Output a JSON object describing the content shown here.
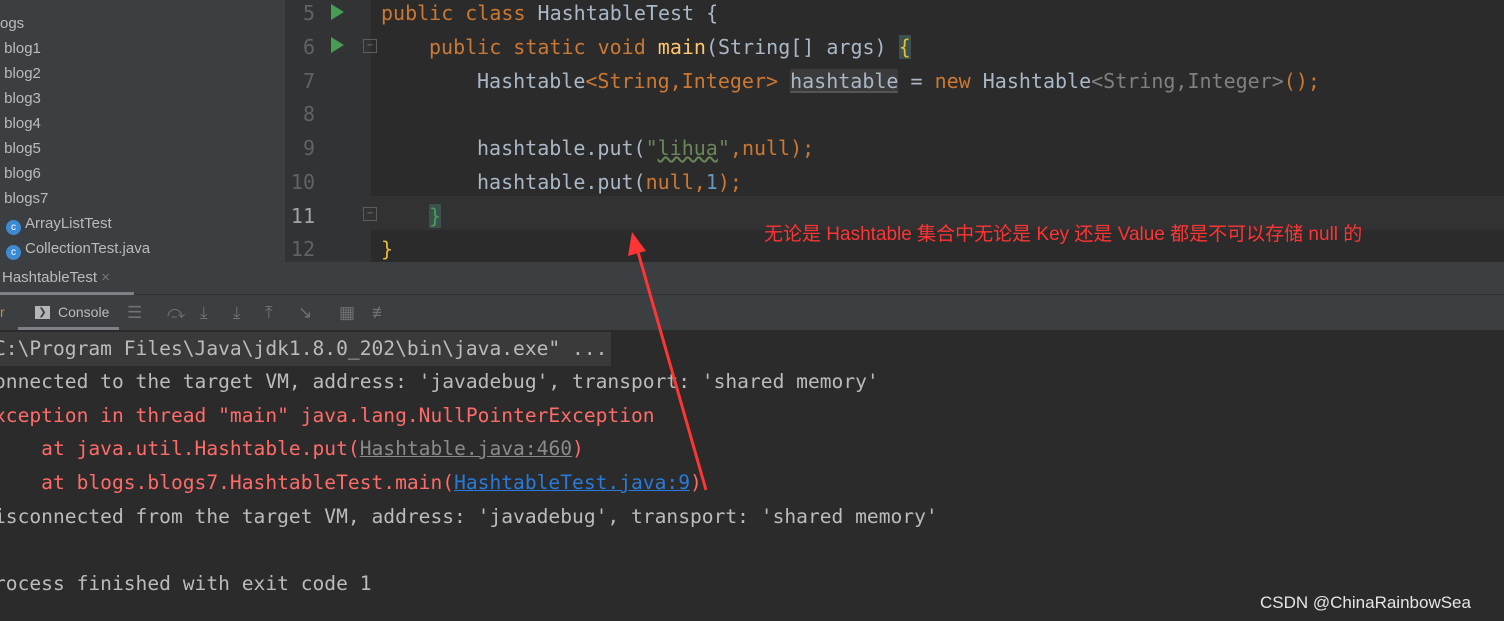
{
  "sidebar": {
    "items": [
      {
        "label": "ogs",
        "type": "folder"
      },
      {
        "label": "blog1",
        "type": "folder"
      },
      {
        "label": "blog2",
        "type": "folder"
      },
      {
        "label": "blog3",
        "type": "folder"
      },
      {
        "label": "blog4",
        "type": "folder"
      },
      {
        "label": "blog5",
        "type": "folder"
      },
      {
        "label": "blog6",
        "type": "folder"
      },
      {
        "label": "blogs7",
        "type": "folder"
      },
      {
        "label": "ArrayListTest",
        "type": "class"
      },
      {
        "label": "CollectionTest.java",
        "type": "class"
      }
    ]
  },
  "editor": {
    "line_numbers": [
      "5",
      "6",
      "7",
      "8",
      "9",
      "10",
      "11",
      "12"
    ],
    "lines": {
      "l5": {
        "kw": "public class ",
        "name": "HashtableTest {"
      },
      "l6": {
        "kw": "public static void ",
        "fn": "main",
        "rest": "(String[] args) ",
        "brace": "{"
      },
      "l7": {
        "a": "Hashtable",
        "b": "<String,Integer> ",
        "var": "hashtable",
        "c": " = ",
        "kw": "new ",
        "d": "Hashtable",
        "e": "<String,Integer>",
        "f": "();"
      },
      "l9": {
        "a": "hashtable.put(",
        "q1": "\"",
        "s": "lihua",
        "q2": "\"",
        "c": ",",
        "kw": "null",
        "d": ");"
      },
      "l10": {
        "a": "hashtable.put(",
        "kw": "null",
        "c": ",",
        "n": "1",
        "d": ");"
      },
      "l11": {
        "brace": "}"
      },
      "l12": {
        "brace": "}"
      }
    }
  },
  "run_tab": {
    "label": "HashtableTest",
    "close": "×"
  },
  "toolbar": {
    "partial_tab": "r",
    "console_label": "Console"
  },
  "console": {
    "l1": "C:\\Program Files\\Java\\jdk1.8.0_202\\bin\\java.exe\" ...",
    "l2": "onnected to the target VM, address: 'javadebug', transport: 'shared memory'",
    "l3": "xception in thread \"main\" java.lang.NullPointerException",
    "l4a": "    at java.util.Hashtable.put(",
    "l4link": "Hashtable.java:460",
    "l4b": ")",
    "l5a": "    at blogs.blogs7.HashtableTest.main(",
    "l5link": "HashtableTest.java:9",
    "l5b": ")",
    "l6": "isconnected from the target VM, address: 'javadebug', transport: 'shared memory'",
    "l8": "rocess finished with exit code 1"
  },
  "annotation": "无论是 Hashtable 集合中无论是 Key 还是 Value 都是不可以存储 null 的",
  "watermark": "CSDN @ChinaRainbowSea",
  "colors": {
    "keyword": "#cc7832",
    "error": "#ff6b68",
    "link": "#287bde",
    "annotation": "#ff3434"
  }
}
